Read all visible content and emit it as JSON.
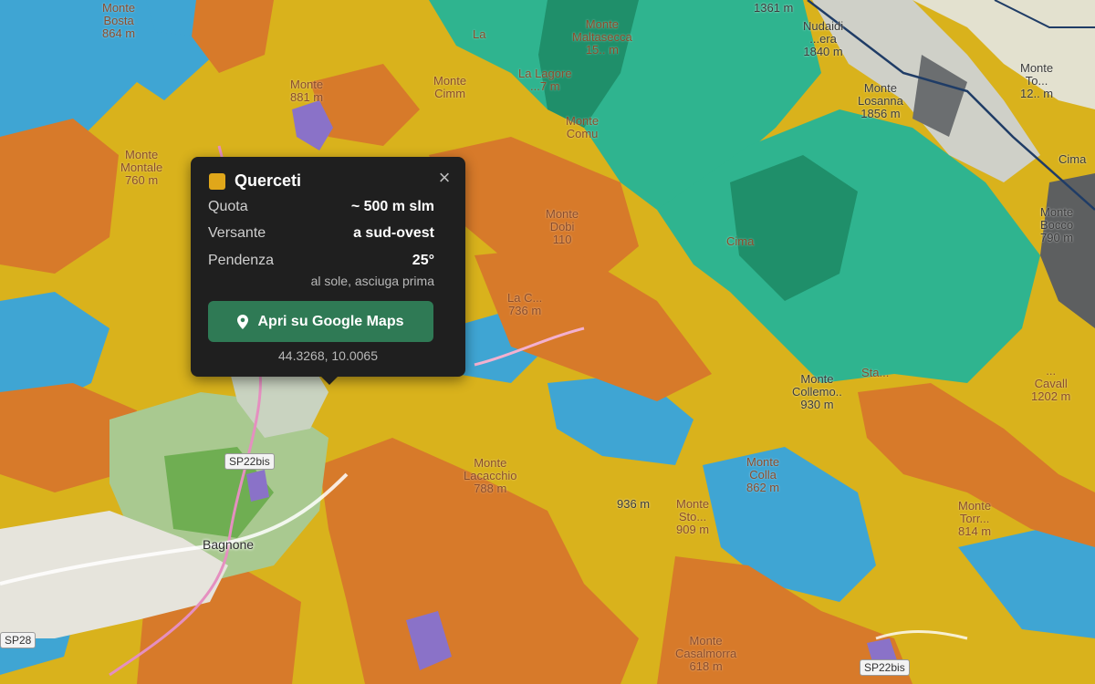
{
  "colors": {
    "base_yellow": "#d9b21c",
    "orange": "#d77a2a",
    "blue": "#3fa5d3",
    "teal": "#2fb48f",
    "dark_green": "#1f8f6a",
    "grey_relief": "#9aa0a0",
    "light_green": "#b9dcb0",
    "purple": "#8a72c8",
    "popup_bg": "#1f1f1f",
    "button_green": "#2f7a55",
    "swatch": "#e0a71a",
    "boundary": "#1f3c66"
  },
  "map_labels": {
    "monte_bosta": "Monte\nBosta\n864 m",
    "monte_881": "Monte\n881 m",
    "monte_cimm": "Monte\nCimm",
    "la_1": "La",
    "la_2": "La Lagore\n...7 m",
    "monte_maltasecca": "Monte\nMaltasecca\n15.. m",
    "m_1361": "1361 m",
    "nudaidi": "Nudaidi\n...era\n1840 m",
    "losanna": "Monte\nLosanna\n1856 m",
    "cima_right": "Cima",
    "monte_right_top": "Monte\nTo...\n12.. m",
    "monte_montale": "Monte\nMontale\n760 m",
    "monte_dobi": "Monte\nDobi\n110",
    "monte_comunaglia": "Monte\nComu",
    "cima": "Cima",
    "monte_bocco": "Monte\nBocco\n790 m",
    "la_coste": "La C...\n736 m",
    "monte_collemore": "Monte\nCollemo..\n930 m",
    "cavallo": "...\nCavall\n1202 m",
    "sf": "Sta...",
    "monte_lacoche": "Monte\nLacacchio\n788 m",
    "m_936": "936 m",
    "monte_sto": "Monte\nSto...\n909 m",
    "monte_colla": "Monte\nColla\n862 m",
    "monte_torre": "Monte\nTorr...\n814 m",
    "monte_casalmorra": "Monte\nCasalmorra\n618 m",
    "bagnone": "Bagnone"
  },
  "road_shields": {
    "sp22bis_a": "SP22bis",
    "sp22bis_b": "SP22bis",
    "sp28": "SP28"
  },
  "popup": {
    "title": "Querceti",
    "close": "×",
    "rows": [
      {
        "key": "Quota",
        "value": "~ 500 m slm"
      },
      {
        "key": "Versante",
        "value": "a sud-ovest"
      },
      {
        "key": "Pendenza",
        "value": "25°"
      }
    ],
    "note": "al sole, asciuga prima",
    "button_label": "Apri su Google Maps",
    "coordinates": "44.3268, 10.0065"
  }
}
